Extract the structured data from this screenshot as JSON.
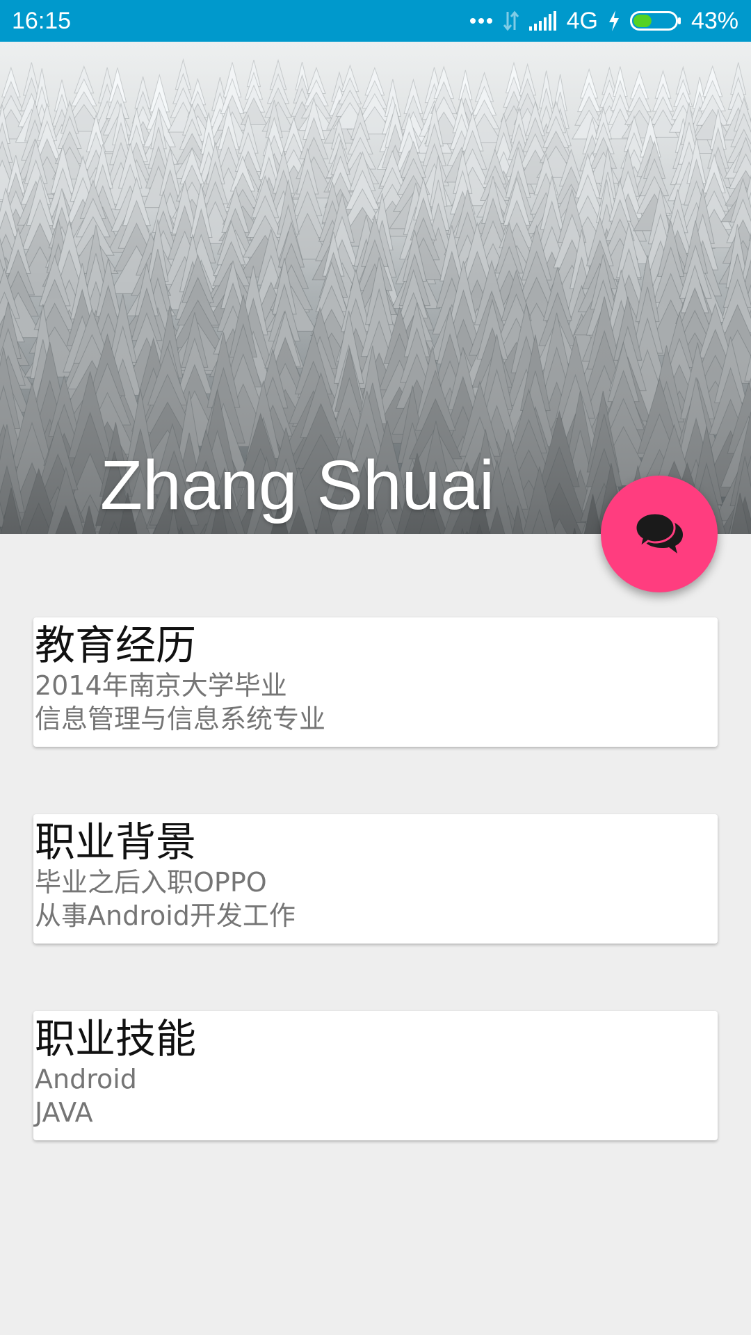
{
  "status_bar": {
    "time": "16:15",
    "network": "4G",
    "battery_percent": "43%",
    "battery_level": 0.43
  },
  "profile": {
    "name": "Zhang Shuai"
  },
  "fab": {
    "icon": "chat-bubbles-icon",
    "color": "#ff3d7f"
  },
  "cards": [
    {
      "title": "教育经历",
      "lines": [
        "2014年南京大学毕业",
        "信息管理与信息系统专业"
      ]
    },
    {
      "title": "职业背景",
      "lines": [
        "毕业之后入职OPPO",
        "从事Android开发工作"
      ]
    },
    {
      "title": "职业技能",
      "lines": [
        "Android",
        "JAVA"
      ]
    }
  ],
  "colors": {
    "status_bar": "#0099cc",
    "background": "#eeeeee",
    "accent": "#ff3d7f"
  }
}
